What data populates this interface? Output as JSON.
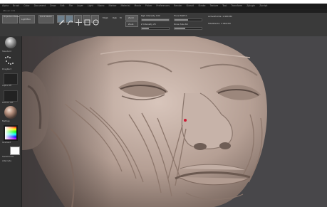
{
  "menu": [
    "Alpha",
    "Brush",
    "Color",
    "Document",
    "Draw",
    "Edit",
    "File",
    "Layer",
    "Light",
    "Macro",
    "Marker",
    "Material",
    "Movie",
    "Picker",
    "Preferences",
    "Render",
    "Stencil",
    "Stroke",
    "Texture",
    "Tool",
    "Transform",
    "Zplugin",
    "Zscript"
  ],
  "subbar_text": "ZBrush 4 R5",
  "toolbar": {
    "lightbox": "LightBox",
    "projection": "Projection Master",
    "quick_sketch": "Quick Sketch",
    "edit": "Edit",
    "draw": "Draw",
    "move": "Move",
    "scale": "Scale",
    "rotate": "Rotate",
    "mrgb": "Mrgb",
    "rgb": "Rgb",
    "m": "M",
    "zadd": "Zadd",
    "zsub": "Zsub",
    "focal_label": "Focal Shift 0",
    "draw_size_label": "Draw Size 64",
    "z_intensity_label": "Z Intensity 25",
    "rgb_intensity_label": "Rgb Intensity 100",
    "active_points": "ActivePoints: 1.969 Mil",
    "total_points": "TotalPoints: 1.969 Mil"
  },
  "leftbar": {
    "brush_label": "Standard",
    "stroke_label": "DragRect",
    "alpha_label": "Alpha Off",
    "texture_label": "Texture Off",
    "material_label": "MatCap",
    "gradient_label": "Gradient",
    "switch_label": "SwitchColor",
    "alternate_label": "Alternate"
  },
  "colors": {
    "background": "#48474a",
    "skin": "#b9a59b",
    "marker": "#cc1a33"
  },
  "icons": [
    "brush-sphere-icon",
    "stroke-dots-icon",
    "alpha-square-icon",
    "material-sphere-icon",
    "color-picker-icon",
    "white-swatch-icon",
    "edit-icon",
    "draw-icon",
    "move-icon",
    "scale-icon",
    "rotate-icon"
  ]
}
